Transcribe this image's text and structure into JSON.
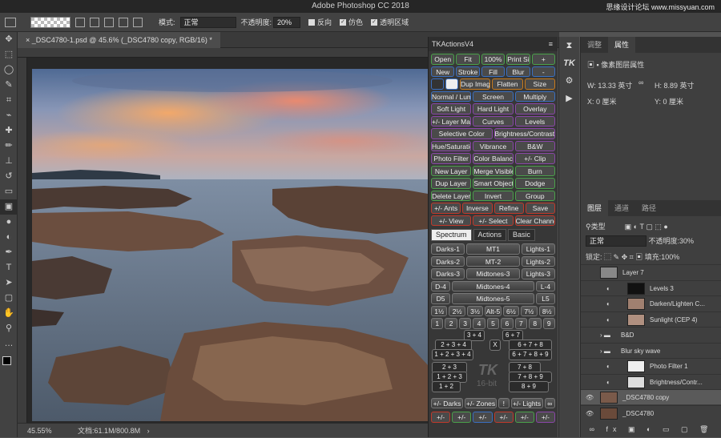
{
  "app_title": "Adobe Photoshop CC 2018",
  "watermark": "思缘设计论坛 www.missyuan.com",
  "options": {
    "mode_label": "模式:",
    "mode_value": "正常",
    "opacity_label": "不透明度:",
    "opacity_value": "20%",
    "reverse": "反向",
    "dither": "仿色",
    "transparency": "透明区域"
  },
  "document_tab": "_DSC4780-1.psd @ 45.6% (_DSC4780 copy, RGB/16) *",
  "status": {
    "zoom": "45.55%",
    "doc": "文档:61.1M/800.8M"
  },
  "tk": {
    "title": "TKActionsV4",
    "rows": [
      [
        [
          "Open",
          "gb"
        ],
        [
          "Fit",
          "gb"
        ],
        [
          "100%",
          "gb"
        ],
        [
          "Print Size",
          "gb"
        ],
        [
          "+",
          "gb"
        ]
      ],
      [
        [
          "New",
          "bb"
        ],
        [
          "Stroke",
          "bb"
        ],
        [
          "Fill",
          "bb"
        ],
        [
          "Blur",
          "bb"
        ],
        [
          "-",
          "bb"
        ]
      ],
      [
        [
          "",
          "bb"
        ],
        [
          "",
          "bb"
        ],
        [
          "Dup Image",
          "ob"
        ],
        [
          "Flatten",
          "ob"
        ],
        [
          "Size",
          "ob"
        ]
      ],
      [
        [
          "Normal / Lum",
          "bb"
        ],
        [
          "Screen",
          "bb"
        ],
        [
          "Multiply",
          "bb"
        ]
      ],
      [
        [
          "Soft Light",
          "pb"
        ],
        [
          "Hard Light",
          "pb"
        ],
        [
          "Overlay",
          "pb"
        ]
      ],
      [
        [
          "+/- Layer Mask",
          "pb"
        ],
        [
          "Curves",
          "pb"
        ],
        [
          "Levels",
          "pb"
        ]
      ],
      [
        [
          "Selective Color",
          "pb"
        ],
        [
          "Brightness/Contrast",
          "pb"
        ]
      ],
      [
        [
          "Hue/Saturation",
          "pb"
        ],
        [
          "Vibrance",
          "pb"
        ],
        [
          "B&W",
          "pb"
        ]
      ],
      [
        [
          "Photo Filter",
          "pb"
        ],
        [
          "Color Balance",
          "pb"
        ],
        [
          "+/- Clip",
          "pb"
        ]
      ],
      [
        [
          "New Layer",
          "gb"
        ],
        [
          "Merge Visible",
          "gb"
        ],
        [
          "Burn",
          "gb"
        ]
      ],
      [
        [
          "Dup Layer",
          "gb"
        ],
        [
          "Smart Object",
          "gb"
        ],
        [
          "Dodge",
          "gb"
        ]
      ],
      [
        [
          "Delete Layer",
          "gb"
        ],
        [
          "Invert",
          "gb"
        ],
        [
          "Group",
          "gb"
        ]
      ],
      [
        [
          "+/- Ants",
          "rb"
        ],
        [
          "Inverse",
          "rb"
        ],
        [
          "Refine",
          "rb"
        ],
        [
          "Save",
          "rb"
        ]
      ],
      [
        [
          "+/- View",
          "rb"
        ],
        [
          "+/- Select",
          "rb"
        ],
        [
          "Clear Channels",
          "rb"
        ]
      ]
    ],
    "tabs": [
      "Spectrum",
      "Actions",
      "Basic"
    ],
    "spectrum": [
      [
        "Darks-1",
        "MT1",
        "Lights-1"
      ],
      [
        "Darks-2",
        "MT-2",
        "Lights-2"
      ],
      [
        "Darks-3",
        "Midtones-3",
        "Lights-3"
      ],
      [
        "D-4",
        "Midtones-4",
        "L-4"
      ],
      [
        "D5",
        "Midtones-5",
        "L5"
      ]
    ],
    "zones_row": [
      "1½",
      "2½",
      "3½",
      "Alt-5",
      "6½",
      "7½",
      "8½"
    ],
    "num_row": [
      "1",
      "2",
      "3",
      "4",
      "5",
      "6",
      "7",
      "8",
      "9"
    ],
    "zone_blocks": [
      "3 + 4",
      "6 + 7",
      "2 + 3 + 4",
      "X",
      "6 + 7 + 8",
      "1 + 2 + 3 + 4",
      "6 + 7 + 8 + 9",
      "2 + 3",
      "7 + 8",
      "1 + 2 + 3",
      "7 + 8 + 9",
      "1 + 2",
      "8 + 9"
    ],
    "logo": "TK",
    "logo_sub": "16-bit",
    "bottom": [
      "+/- Darks",
      "+/- Zones",
      "!",
      "+/- Lights",
      "∞"
    ],
    "icon_row": [
      "+/-",
      "+/-",
      "+/-",
      "+/-",
      "+/-",
      "+/-"
    ]
  },
  "properties": {
    "tabs": [
      "调整",
      "属性"
    ],
    "title": "像素图层属性",
    "w": "W: 13.33 英寸",
    "h": "H: 8.89 英寸",
    "x": "X: 0 厘米",
    "y": "Y: 0 厘米"
  },
  "layers": {
    "tabs": [
      "图层",
      "通道",
      "路径"
    ],
    "kind": "类型",
    "blend": "正常",
    "opacity_label": "不透明度:",
    "opacity": "30%",
    "lock_label": "锁定:",
    "fill_label": "填充:",
    "fill": "100%",
    "items": [
      "Layer 7",
      "Levels 3",
      "Darken/Lighten C...",
      "Sunlight (CEP 4)",
      "B&D",
      "Blur sky wave",
      "Photo Filter 1",
      "Brightness/Contr...",
      "_DSC4780 copy",
      "_DSC4780"
    ]
  }
}
